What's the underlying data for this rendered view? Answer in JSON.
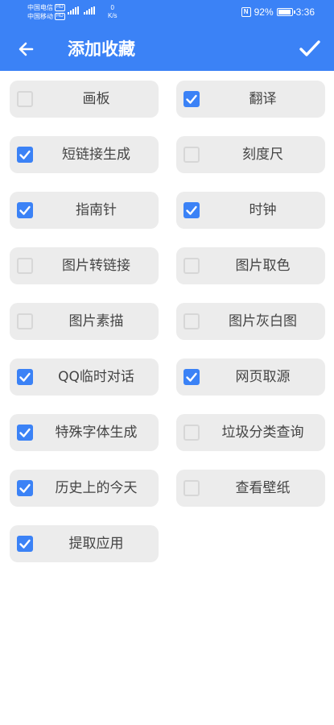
{
  "status_bar": {
    "carrier_1": "中国电信",
    "carrier_2": "中国移动",
    "hd_badge": "HD",
    "net_speed_value": "0",
    "net_speed_unit": "K/s",
    "nfc": "N",
    "battery_percent": "92%",
    "time": "3:36"
  },
  "header": {
    "title": "添加收藏",
    "back_icon": "arrow-left-icon",
    "confirm_icon": "check-icon"
  },
  "colors": {
    "primary": "#3b82f6",
    "card": "#ececec",
    "unchecked_border": "#d7d7d7"
  },
  "items": [
    {
      "label": "画板",
      "checked": false
    },
    {
      "label": "翻译",
      "checked": true
    },
    {
      "label": "短链接生成",
      "checked": true
    },
    {
      "label": "刻度尺",
      "checked": false
    },
    {
      "label": "指南针",
      "checked": true
    },
    {
      "label": "时钟",
      "checked": true
    },
    {
      "label": "图片转链接",
      "checked": false
    },
    {
      "label": "图片取色",
      "checked": false
    },
    {
      "label": "图片素描",
      "checked": false
    },
    {
      "label": "图片灰白图",
      "checked": false
    },
    {
      "label": "QQ临时对话",
      "checked": true
    },
    {
      "label": "网页取源",
      "checked": true
    },
    {
      "label": "特殊字体生成",
      "checked": true
    },
    {
      "label": "垃圾分类查询",
      "checked": false
    },
    {
      "label": "历史上的今天",
      "checked": true
    },
    {
      "label": "查看壁纸",
      "checked": false
    },
    {
      "label": "提取应用",
      "checked": true
    }
  ]
}
